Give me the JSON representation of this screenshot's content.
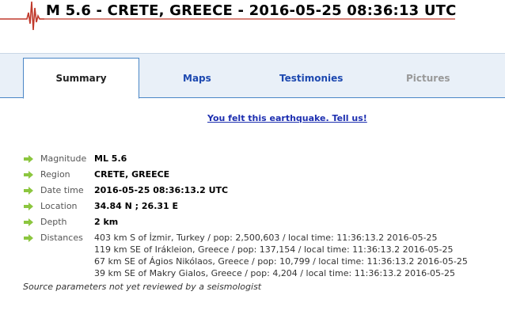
{
  "header": {
    "title": "M 5.6 - CRETE, GREECE - 2016-05-25 08:36:13 UTC"
  },
  "tabs": [
    {
      "label": "Summary",
      "state": "active"
    },
    {
      "label": "Maps",
      "state": "link"
    },
    {
      "label": "Testimonies",
      "state": "link"
    },
    {
      "label": "Pictures",
      "state": "disabled"
    }
  ],
  "felt_link": "You felt this earthquake. Tell us!",
  "details": {
    "magnitude": {
      "label": "Magnitude",
      "value": "ML 5.6"
    },
    "region": {
      "label": "Region",
      "value": "CRETE, GREECE"
    },
    "date_time": {
      "label": "Date time",
      "value": "2016-05-25 08:36:13.2 UTC"
    },
    "location": {
      "label": "Location",
      "value": "34.84 N ; 26.31 E"
    },
    "depth": {
      "label": "Depth",
      "value": "2 km"
    },
    "distances": {
      "label": "Distances",
      "items": [
        "403 km S of İzmir, Turkey / pop: 2,500,603 / local time: 11:36:13.2 2016-05-25",
        "119 km SE of Irákleion, Greece / pop: 137,154 / local time: 11:36:13.2 2016-05-25",
        "67 km SE of Ágios Nikólaos, Greece / pop: 10,799 / local time: 11:36:13.2 2016-05-25",
        "39 km SE of Makry Gialos, Greece / pop: 4,204 / local time: 11:36:13.2 2016-05-25"
      ]
    }
  },
  "note": "Source parameters not yet reviewed by a seismologist",
  "colors": {
    "arrow": "#8cc63f",
    "tab_link": "#1d49b0",
    "seismogram": "#c0392b"
  }
}
